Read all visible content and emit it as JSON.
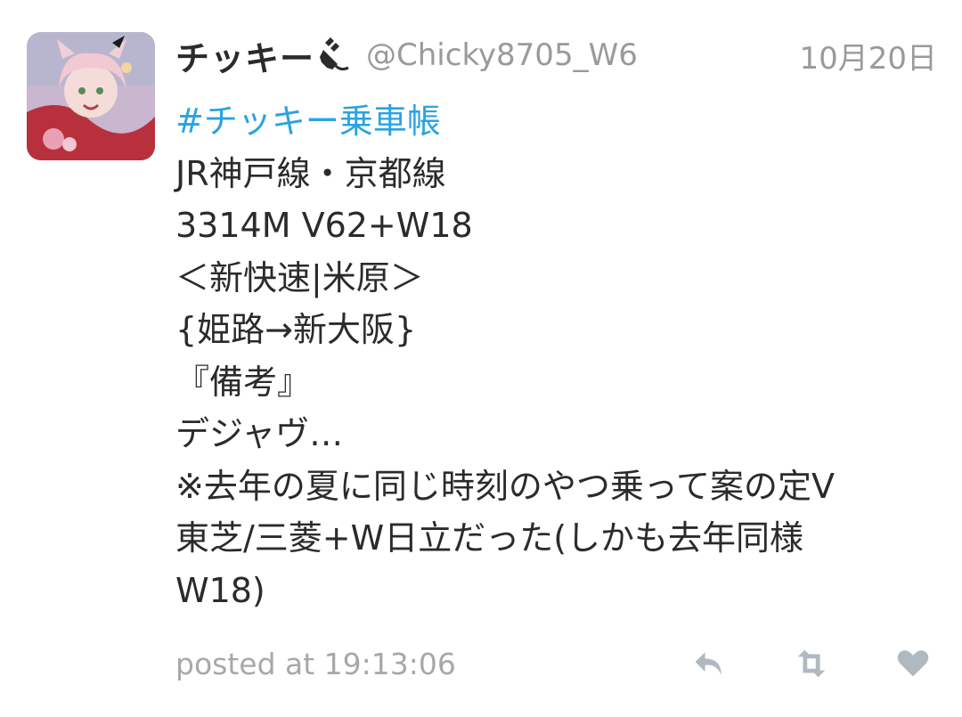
{
  "tweet": {
    "display_name": "チッキー",
    "handle": "@Chicky8705_W6",
    "date": "10月20日",
    "hashtag": "#チッキー乗車帳",
    "lines": [
      "JR神戸線・京都線",
      "3314M V62+W18",
      "＜新快速|米原＞",
      "{姫路→新大阪}",
      "『備考』",
      "デジャヴ…",
      "※去年の夏に同じ時刻のやつ乗って案の定V",
      "東芝/三菱+W日立だった(しかも去年同様",
      "W18)"
    ],
    "posted_at": "posted at 19:13:06"
  },
  "icons": {
    "name_badge": "plug-icon",
    "reply": "reply-icon",
    "retweet": "retweet-icon",
    "like": "heart-icon"
  },
  "colors": {
    "hashtag": "#2aa3e0",
    "meta_text": "#9a9a9a",
    "action_icons": "#b0b8c0"
  }
}
